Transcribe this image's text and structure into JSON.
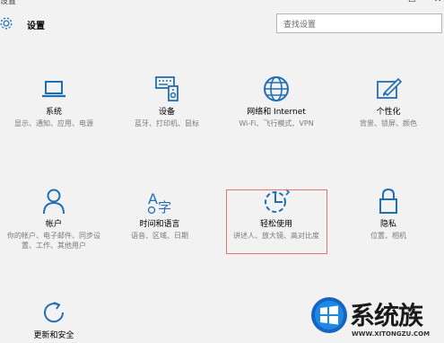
{
  "window": {
    "title": "设置",
    "controls": [
      "—",
      "☐",
      "✕"
    ]
  },
  "header": {
    "title": "设置",
    "search_placeholder": "查找设置"
  },
  "tiles": [
    {
      "name": "系统",
      "desc": "显示、通知、应用、电源",
      "icon": "laptop-icon"
    },
    {
      "name": "设备",
      "desc": "蓝牙、打印机、鼠标",
      "icon": "devices-icon"
    },
    {
      "name": "网络和 Internet",
      "desc": "Wi-Fi、飞行模式、VPN",
      "icon": "globe-icon"
    },
    {
      "name": "个性化",
      "desc": "背景、锁屏、颜色",
      "icon": "paint-icon"
    },
    {
      "name": "帐户",
      "desc": "你的帐户、电子邮件、同步设置、工作、其他用户",
      "icon": "person-icon"
    },
    {
      "name": "时间和语言",
      "desc": "语音、区域、日期",
      "icon": "time-language-icon"
    },
    {
      "name": "轻松使用",
      "desc": "讲述人、放大镜、高对比度",
      "icon": "ease-of-access-icon"
    },
    {
      "name": "隐私",
      "desc": "位置、相机",
      "icon": "lock-icon"
    },
    {
      "name": "更新和安全",
      "desc": "",
      "icon": "refresh-icon"
    }
  ],
  "watermark": {
    "brand": "系统族",
    "url": "WWW.XITONGZU.COM"
  },
  "colors": {
    "accent": "#1f6fb5",
    "highlight_border": "#e57373"
  }
}
